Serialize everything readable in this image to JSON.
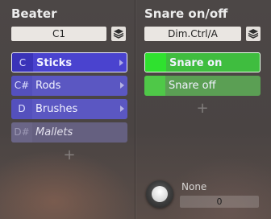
{
  "left": {
    "title": "Beater",
    "selector_value": "C1",
    "rows": [
      {
        "note": "C",
        "label": "Sticks"
      },
      {
        "note": "C#",
        "label": "Rods"
      },
      {
        "note": "D",
        "label": "Brushes"
      },
      {
        "note": "D#",
        "label": "Mallets"
      }
    ],
    "add_label": "+"
  },
  "right": {
    "title": "Snare on/off",
    "selector_value": "Dim.Ctrl/A",
    "rows": [
      {
        "label": "Snare on"
      },
      {
        "label": "Snare off"
      }
    ],
    "add_label": "+",
    "knob": {
      "label": "None",
      "value": "0"
    }
  },
  "colors": {
    "blue_selected": "#3f38c8",
    "blue_row": "#5a56c0",
    "green_selected": "#3bbf3e",
    "green_row": "#5aa052"
  }
}
